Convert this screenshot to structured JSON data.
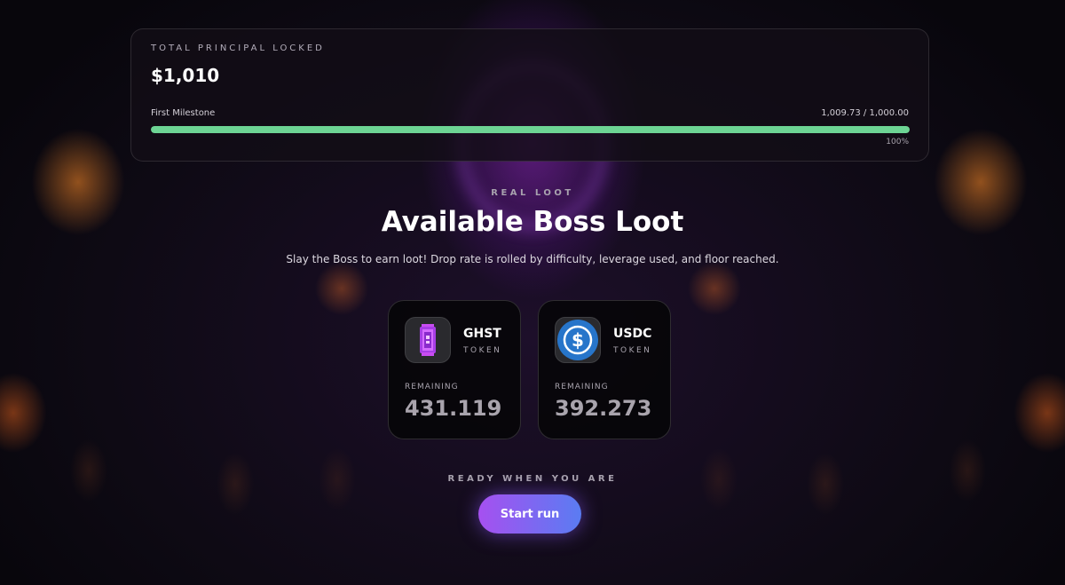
{
  "principal": {
    "label": "TOTAL PRINCIPAL LOCKED",
    "amount": "$1,010",
    "milestone_label": "First Milestone",
    "milestone_value": "1,009.73 / 1,000.00",
    "progress_percent": 100,
    "progress_text": "100%",
    "progress_color": "#6dd494"
  },
  "loot": {
    "eyebrow": "REAL LOOT",
    "title": "Available Boss Loot",
    "subtitle": "Slay the Boss to earn loot! Drop rate is rolled by difficulty, leverage used, and floor reached.",
    "tokens": [
      {
        "icon": "ghst-token-icon",
        "name": "GHST",
        "type": "TOKEN",
        "remaining_label": "REMAINING",
        "remaining": "431.119"
      },
      {
        "icon": "usdc-token-icon",
        "name": "USDC",
        "type": "TOKEN",
        "remaining_label": "REMAINING",
        "remaining": "392.273"
      }
    ]
  },
  "cta": {
    "eyebrow": "READY WHEN YOU ARE",
    "button_label": "Start run",
    "gradient": [
      "#a650f0",
      "#5a7cf2"
    ]
  }
}
